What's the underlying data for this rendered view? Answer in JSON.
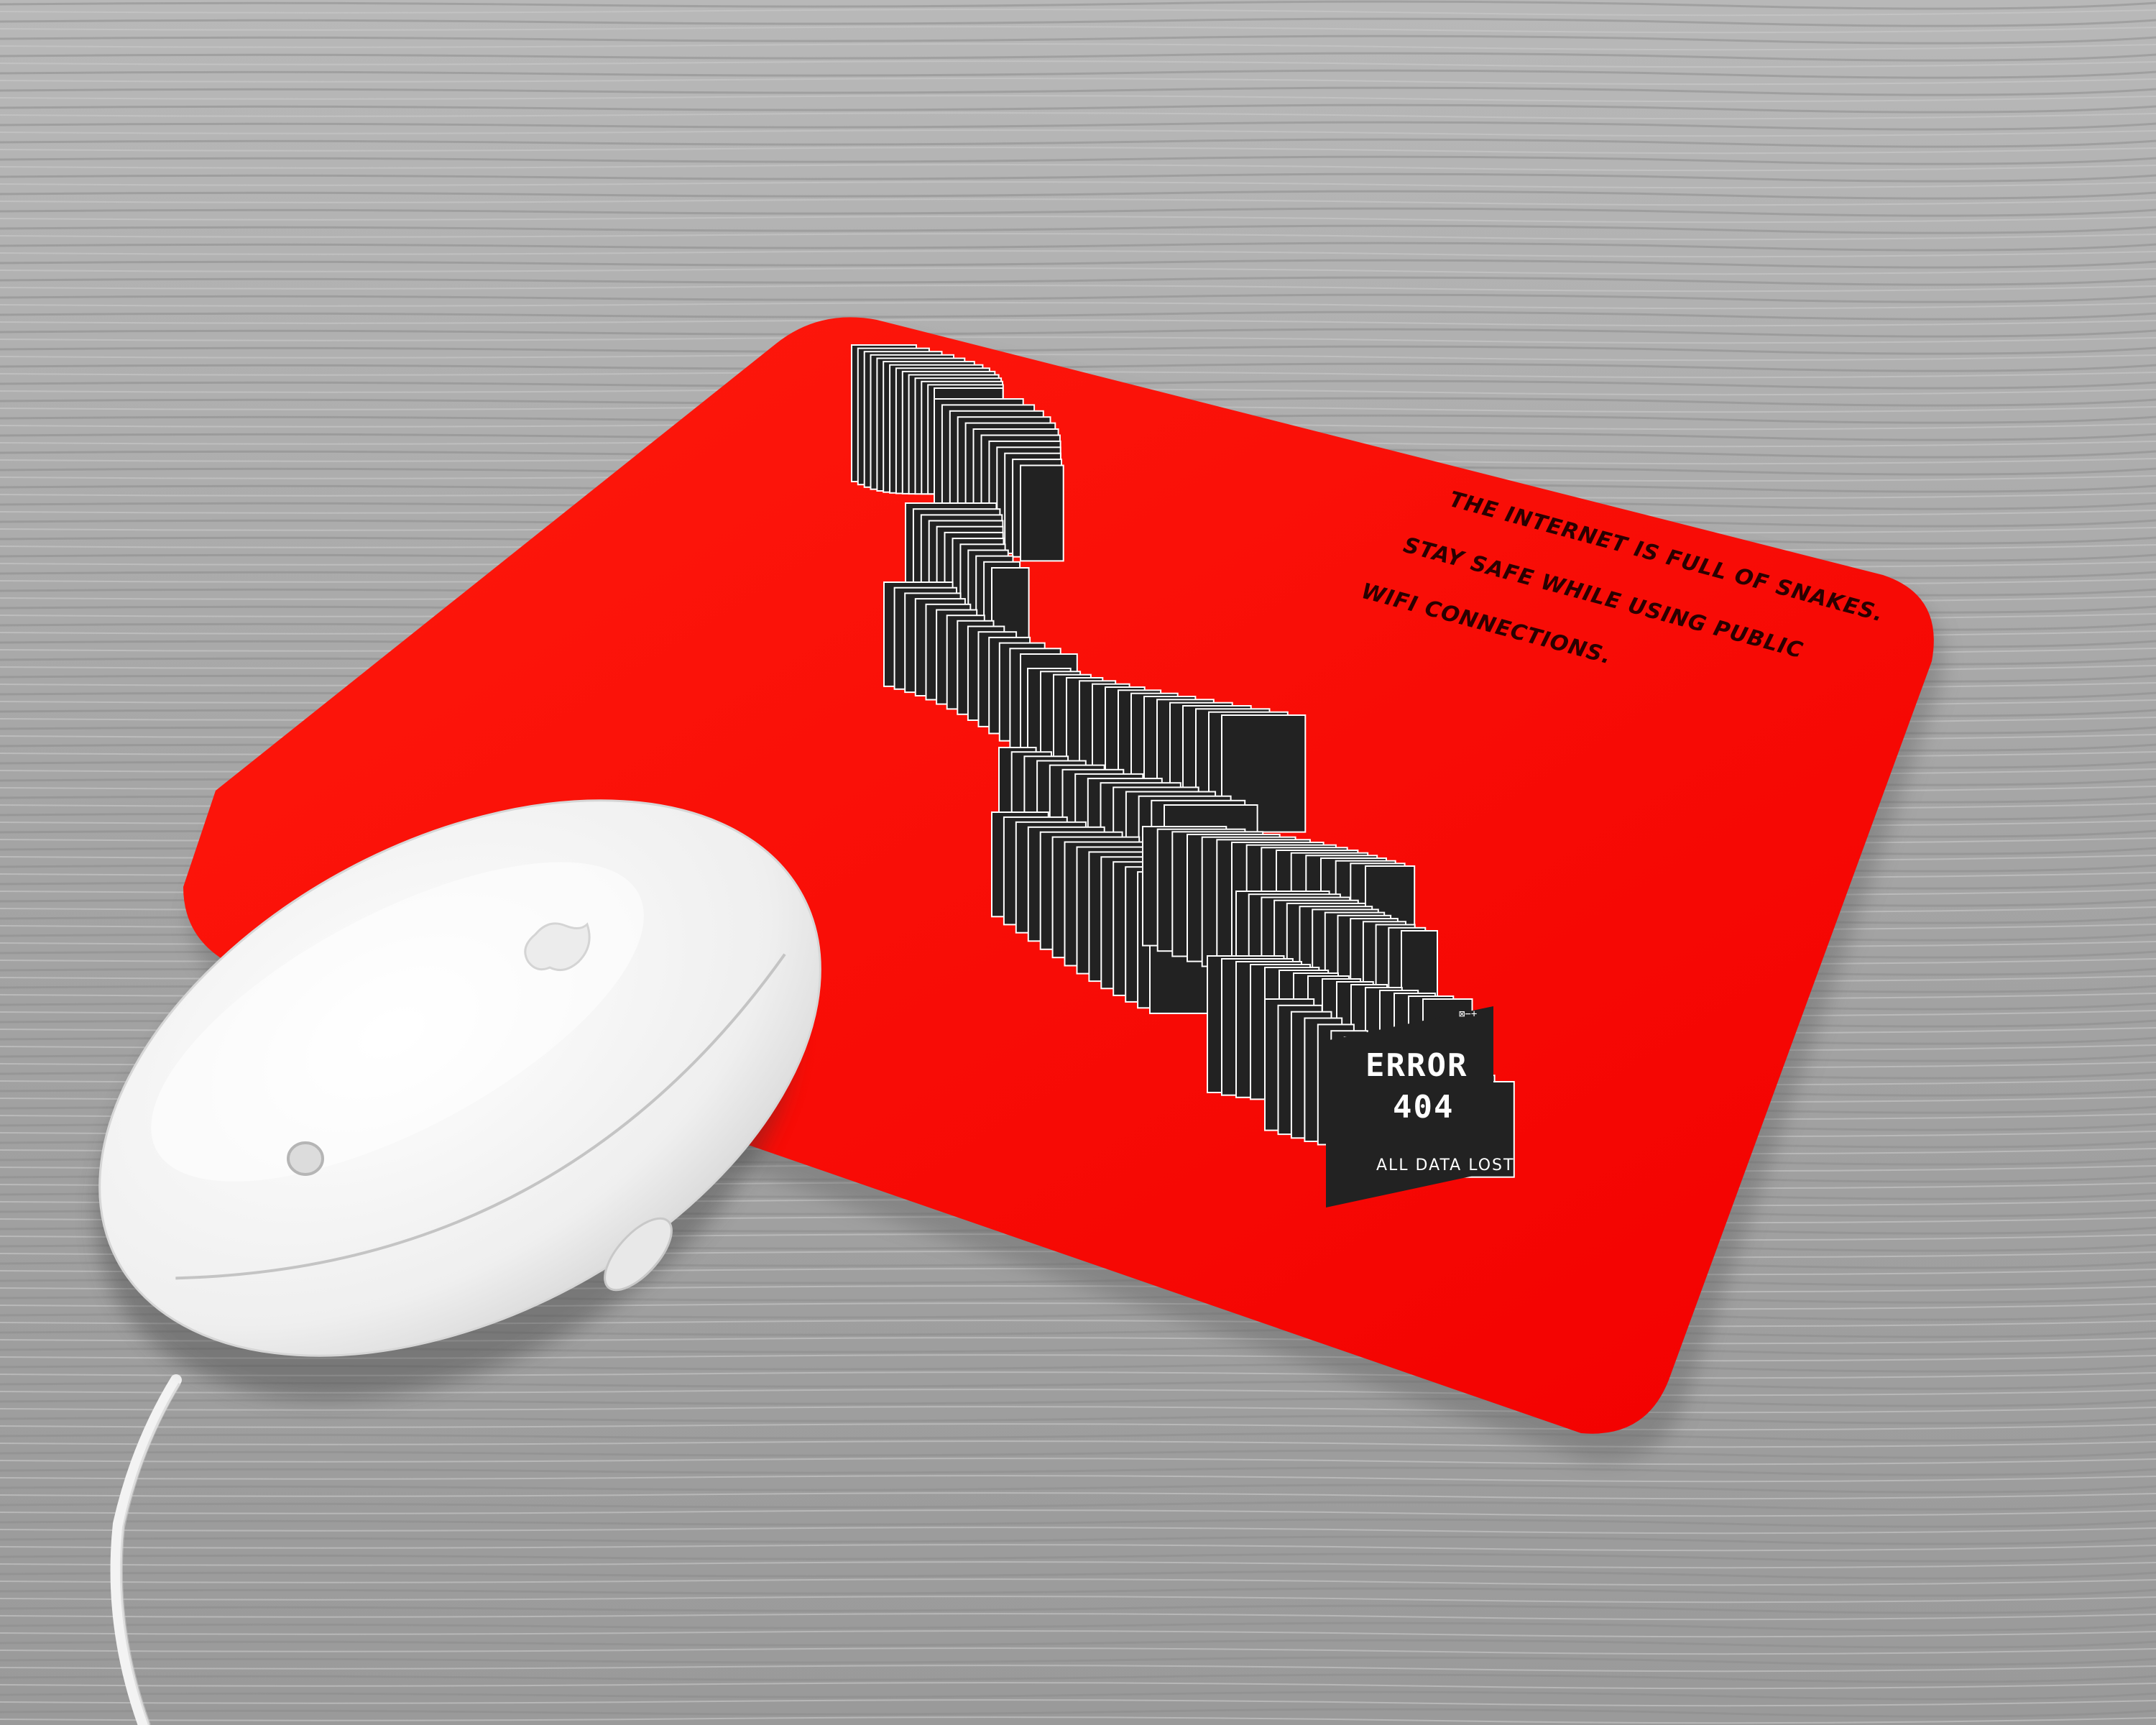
{
  "mousepad": {
    "slogan_line_1": "THE INTERNET IS FULL OF SNAKES.",
    "slogan_line_2": "STAY SAFE WHILE USING PUBLIC",
    "slogan_line_3": "WIFI CONNECTIONS.",
    "error_title_line_1": "ERROR",
    "error_title_line_2": "404",
    "error_subtitle": "ALL DATA LOST",
    "window_controls": "⊠−+",
    "pad_color": "#ff0000",
    "panel_color": "#222222"
  },
  "mouse": {
    "color": "#f4f4f4",
    "logo_icon": "apple-logo-icon"
  },
  "background": {
    "surface": "grey wood grain",
    "color": "#a9a9a9"
  }
}
